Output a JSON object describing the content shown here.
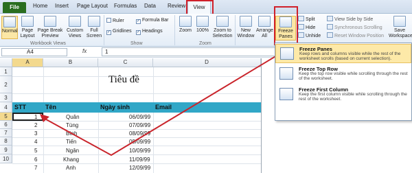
{
  "tabs": {
    "file": "File",
    "home": "Home",
    "insert": "Insert",
    "page_layout": "Page Layout",
    "formulas": "Formulas",
    "data": "Data",
    "review": "Review",
    "view": "View"
  },
  "ribbon": {
    "normal": "Normal",
    "page_layout": "Page Layout",
    "page_break_preview": "Page Break Preview",
    "custom_views": "Custom Views",
    "full_screen": "Full Screen",
    "ruler": "Ruler",
    "formula_bar": "Formula Bar",
    "gridlines": "Gridlines",
    "headings": "Headings",
    "zoom": "Zoom",
    "zoom100": "100%",
    "zoom_to_selection": "Zoom to Selection",
    "new_window": "New Window",
    "arrange_all": "Arrange All",
    "freeze_panes": "Freeze Panes",
    "split": "Split",
    "hide": "Hide",
    "unhide": "Unhide",
    "view_side_by_side": "View Side by Side",
    "synchronous_scrolling": "Synchronous Scrolling",
    "reset_window_position": "Reset Window Position",
    "save_workspace": "Save Workspace",
    "group_workbook_views": "Workbook Views",
    "group_show": "Show",
    "group_zoom": "Zoom"
  },
  "formula_bar": {
    "name_box": "A4",
    "fx": "fx",
    "value": "1"
  },
  "columns": [
    "A",
    "B",
    "C",
    "D"
  ],
  "rows": [
    "1",
    "2",
    "3",
    "4",
    "5",
    "6",
    "7",
    "8",
    "9",
    "10"
  ],
  "sheet": {
    "title": "Tiêu đề",
    "headers": {
      "stt": "STT",
      "ten": "Tên",
      "ngay_sinh": "Ngày sinh",
      "email": "Email"
    },
    "data": [
      {
        "stt": "1",
        "ten": "Quân",
        "ngay": "06/09/99"
      },
      {
        "stt": "2",
        "ten": "Tùng",
        "ngay": "07/09/99"
      },
      {
        "stt": "3",
        "ten": "Bình",
        "ngay": "08/09/99"
      },
      {
        "stt": "4",
        "ten": "Tiến",
        "ngay": "09/09/99"
      },
      {
        "stt": "5",
        "ten": "Ngân",
        "ngay": "10/09/99"
      },
      {
        "stt": "6",
        "ten": "Khang",
        "ngay": "11/09/99"
      },
      {
        "stt": "7",
        "ten": "Anh",
        "ngay": "12/09/99"
      }
    ]
  },
  "dropdown": [
    {
      "title": "Freeze Panes",
      "desc": "Keep rows and columns visible while the rest of the worksheet scrolls (based on current selection)."
    },
    {
      "title": "Freeze Top Row",
      "desc": "Keep the top row visible while scrolling through the rest of the worksheet."
    },
    {
      "title": "Freeze First Column",
      "desc": "Keep the first column visible while scrolling through the rest of the worksheet."
    }
  ],
  "colors": {
    "accent_red": "#d0202a",
    "header_band": "#31a7c7",
    "file_tab": "#2a6e1f",
    "highlight": "#fde9a8"
  }
}
